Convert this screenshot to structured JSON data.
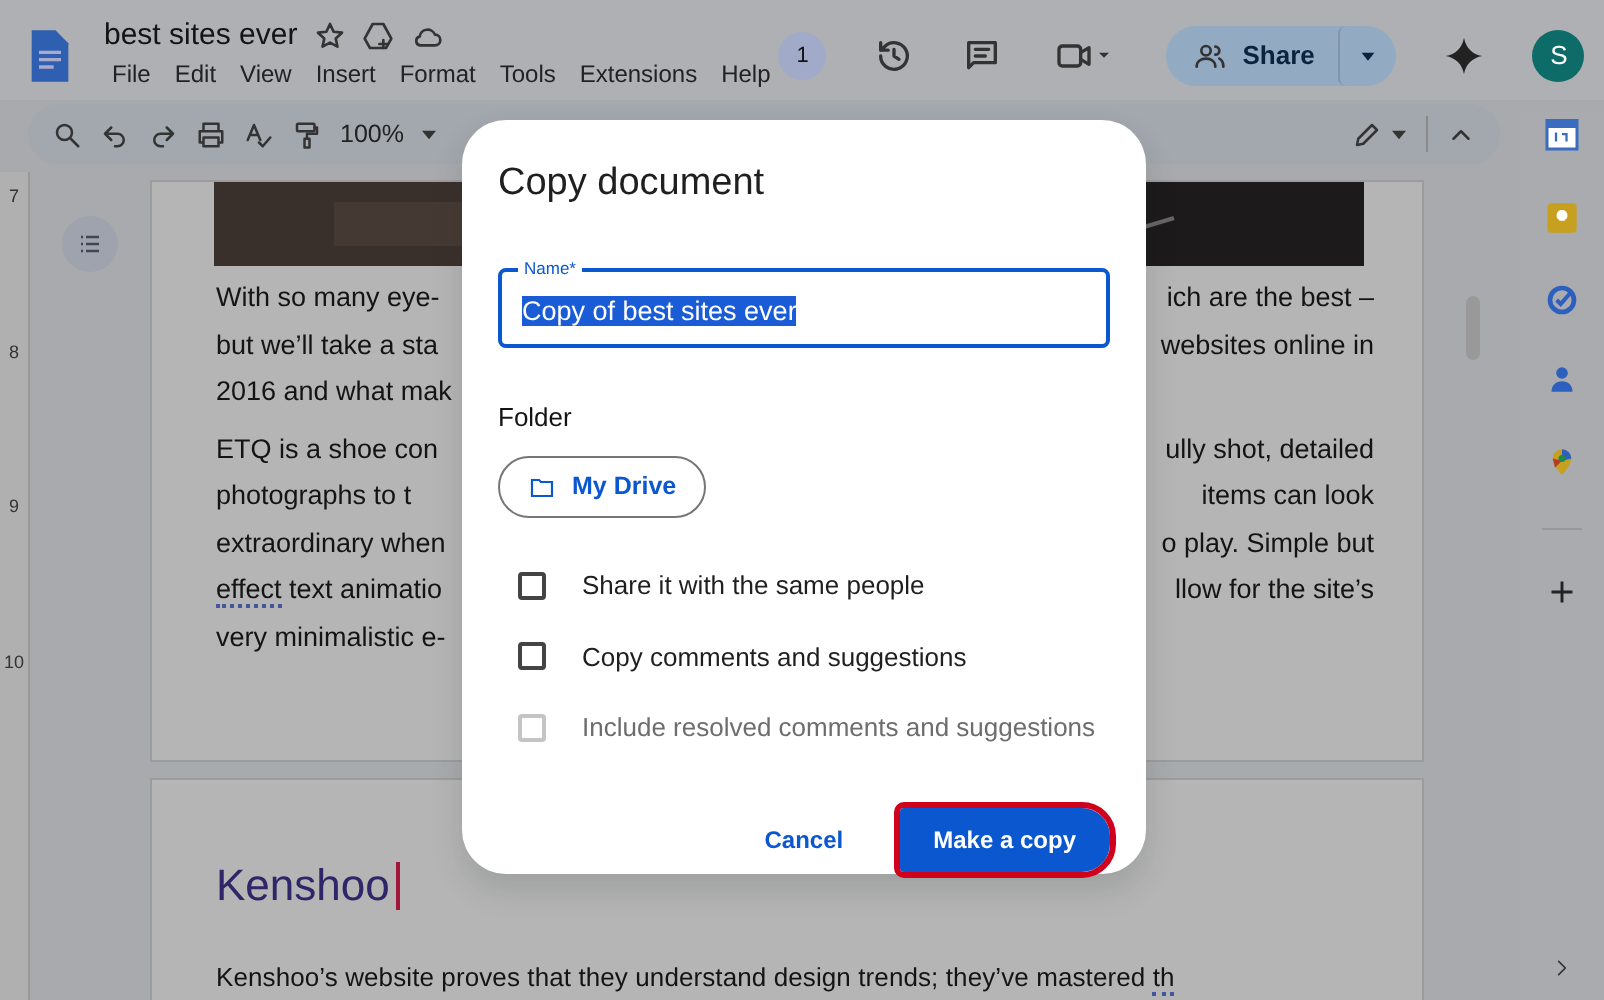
{
  "header": {
    "title": "best sites ever",
    "menu": [
      "File",
      "Edit",
      "View",
      "Insert",
      "Format",
      "Tools",
      "Extensions",
      "Help"
    ],
    "viewers": "1",
    "share": "Share",
    "avatar": "S"
  },
  "toolbar": {
    "zoom": "100%"
  },
  "ruler": [
    "7",
    "8",
    "9",
    "10"
  ],
  "page": {
    "lines": [
      {
        "left": [
          {
            "text": "With so many eye-",
            "misspelled": false
          }
        ],
        "right": [
          {
            "text": "ich are the best –",
            "misspelled": false
          }
        ]
      },
      {
        "left": [
          {
            "text": "but we’ll take a sta",
            "misspelled": false
          }
        ],
        "right": [
          {
            "text": "websites online in",
            "misspelled": false
          }
        ]
      },
      {
        "left": [
          {
            "text": "2016 and what mak",
            "misspelled": false
          }
        ]
      },
      {
        "left": [
          {
            "text": "ETQ is a shoe con",
            "misspelled": false
          }
        ],
        "right": [
          {
            "text": "ully shot, detailed",
            "misspelled": false
          }
        ]
      },
      {
        "left": [
          {
            "text": "photographs  to  t",
            "misspelled": false
          }
        ],
        "right": [
          {
            "text": "items  can  look",
            "misspelled": false
          }
        ]
      },
      {
        "left": [
          {
            "text": "extraordinary when",
            "misspelled": false
          }
        ],
        "right": [
          {
            "text": "o play. Simple but",
            "misspelled": false
          }
        ]
      },
      {
        "left": [
          {
            "text": "effect",
            "misspelled": true
          },
          {
            "text": " text animatio",
            "misspelled": false
          }
        ],
        "right": [
          {
            "text": "llow for the site’s",
            "misspelled": false
          }
        ]
      },
      {
        "left": [
          {
            "text": "very minimalistic e-",
            "misspelled": false
          }
        ]
      }
    ],
    "heading": "Kenshoo",
    "last_line": [
      {
        "text": "Kenshoo’s  website  proves  that  they  understand  design  trends;  they’ve  mastered  ",
        "misspelled": false
      },
      {
        "text": "th",
        "misspelled": true
      }
    ]
  },
  "dialog": {
    "title": "Copy document",
    "name_label": "Name",
    "required_mark": "*",
    "name_value": "Copy of best sites ever",
    "name_selected": true,
    "folder_label": "Folder",
    "folder": "My Drive",
    "options": [
      {
        "label": "Share it with the same people",
        "checked": false,
        "disabled": false
      },
      {
        "label": "Copy comments and suggestions",
        "checked": false,
        "disabled": false
      },
      {
        "label": "Include resolved comments and suggestions",
        "checked": false,
        "disabled": true
      }
    ],
    "cancel": "Cancel",
    "confirm": "Make a copy",
    "confirm_highlighted": true
  }
}
